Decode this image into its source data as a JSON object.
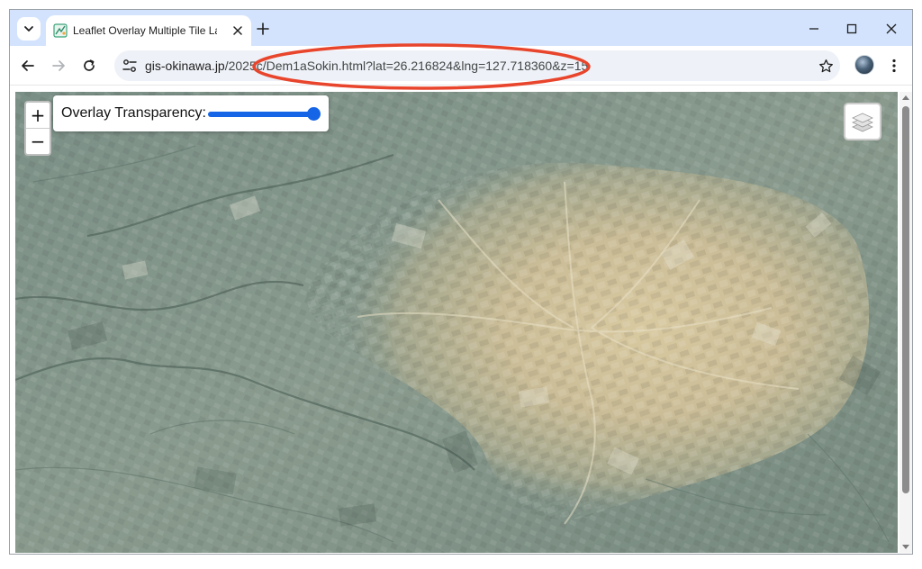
{
  "browser": {
    "tab": {
      "title": "Leaflet Overlay Multiple Tile Layers"
    },
    "url": {
      "host": "gis-okinawa.jp",
      "path": "/2025c/Dem1aSokin.html?lat=26.216824&lng=127.718360&z=15"
    },
    "icons": {
      "tab_search": "chevron-down-icon",
      "favicon": "map-favicon-icon",
      "close": "close-icon",
      "new_tab": "plus-icon",
      "minimize": "minimize-icon",
      "maximize": "maximize-icon",
      "window_close": "close-icon",
      "back": "arrow-left-icon",
      "forward": "arrow-right-icon",
      "reload": "reload-icon",
      "site_info": "tune-icon",
      "bookmark": "star-icon",
      "profile": "avatar-icon",
      "menu": "kebab-menu-icon"
    },
    "annotation_color": "#e8452c"
  },
  "map": {
    "zoom_in_label": "+",
    "zoom_out_label": "−",
    "opacity_control": {
      "label": "Overlay Transparency:",
      "value": 1.0
    },
    "layers_icon": "layers-icon",
    "colors": {
      "lowland": "#7f948a",
      "highland": "#cdbf98",
      "slider_accent": "#1565e6"
    }
  }
}
